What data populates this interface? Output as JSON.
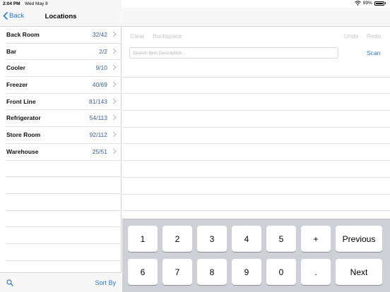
{
  "status_bar": {
    "time": "2:04 PM",
    "date": "Wed May 8",
    "battery": "99%"
  },
  "left_panel": {
    "back_label": "Back",
    "title": "Locations",
    "locations": [
      {
        "name": "Back Room",
        "count": "32/42"
      },
      {
        "name": "Bar",
        "count": "2/2"
      },
      {
        "name": "Cooler",
        "count": "9/10"
      },
      {
        "name": "Freezer",
        "count": "40/69"
      },
      {
        "name": "Front Line",
        "count": "81/143"
      },
      {
        "name": "Refrigerator",
        "count": "54/113"
      },
      {
        "name": "Store Room",
        "count": "92/112"
      },
      {
        "name": "Warehouse",
        "count": "25/51"
      }
    ],
    "sort_label": "Sort By"
  },
  "toolbar": {
    "clear": "Clear",
    "backspace": "Backspace",
    "undo": "Undo",
    "redo": "Redo"
  },
  "search": {
    "placeholder": "Search Item Description...",
    "scan_label": "Scan"
  },
  "keypad": {
    "row1": [
      "1",
      "2",
      "3",
      "4",
      "5",
      "+"
    ],
    "row2": [
      "6",
      "7",
      "8",
      "9",
      "0",
      "."
    ],
    "previous_label": "Previous",
    "next_label": "Next"
  },
  "colors": {
    "accent": "#2a78d8",
    "count": "#3a5fa0",
    "keypad_bg": "#cdd0d6",
    "disabled": "#c7c7cc"
  }
}
